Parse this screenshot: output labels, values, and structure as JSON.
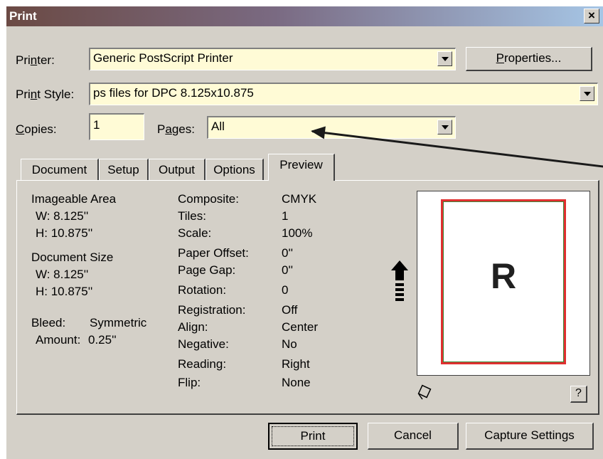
{
  "title": "Print",
  "close_label": "×",
  "printer": {
    "label": "Printer:",
    "value": "Generic PostScript Printer",
    "properties_label": "Properties..."
  },
  "print_style": {
    "label": "Print Style:",
    "value": "ps files for DPC 8.125x10.875"
  },
  "copies": {
    "label": "Copies:",
    "value": "1"
  },
  "pages": {
    "label": "Pages:",
    "value": "All"
  },
  "tabs": [
    {
      "label": "Document"
    },
    {
      "label": "Setup"
    },
    {
      "label": "Output"
    },
    {
      "label": "Options"
    },
    {
      "label": "Preview",
      "active": true
    }
  ],
  "preview": {
    "imageable_area": {
      "title": "Imageable Area",
      "w": "W: 8.125''",
      "h": "H: 10.875''"
    },
    "document_size": {
      "title": "Document Size",
      "w": "W: 8.125''",
      "h": "H: 10.875''"
    },
    "bleed": {
      "label": "Bleed:",
      "value": "Symmetric"
    },
    "amount": {
      "label": "Amount:",
      "value": "0.25''"
    },
    "settings": [
      {
        "label": "Composite:",
        "value": "CMYK"
      },
      {
        "label": "Tiles:",
        "value": "1"
      },
      {
        "label": "Scale:",
        "value": "100%"
      },
      {
        "label": "Paper Offset:",
        "value": "0''"
      },
      {
        "label": "Page Gap:",
        "value": "0''"
      },
      {
        "label": "Rotation:",
        "value": "0"
      },
      {
        "label": "Registration:",
        "value": "Off"
      },
      {
        "label": "Align:",
        "value": "Center"
      },
      {
        "label": "Negative:",
        "value": "No"
      },
      {
        "label": "Reading:",
        "value": "Right"
      },
      {
        "label": "Flip:",
        "value": "None"
      }
    ],
    "page_letter": "R",
    "help_label": "?"
  },
  "buttons": {
    "print": "Print",
    "cancel": "Cancel",
    "capture": "Capture Settings"
  },
  "colors": {
    "field_bg": "#fffbd6",
    "dialog_bg": "#d4d0c8",
    "page_border": "#e03030",
    "inner_border": "#3a8a3a"
  }
}
